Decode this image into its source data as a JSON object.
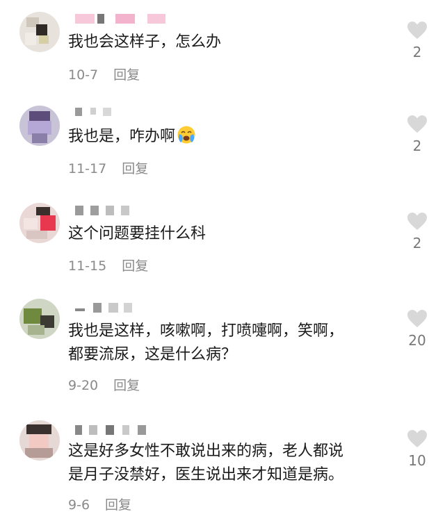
{
  "comments": [
    {
      "text": "我也会这样子，怎么办",
      "date": "10-7",
      "reply_label": "回复",
      "likes": "2"
    },
    {
      "text": "我也是，咋办啊",
      "emoji": "crying-face-emoji",
      "date": "11-17",
      "reply_label": "回复",
      "likes": "2"
    },
    {
      "text": "这个问题要挂什么科",
      "date": "11-15",
      "reply_label": "回复",
      "likes": "2"
    },
    {
      "text": "我也是这样，咳嗽啊，打喷嚏啊，笑啊，\n都要流尿，这是什么病？",
      "date": "9-20",
      "reply_label": "回复",
      "likes": "20"
    },
    {
      "text": "这是好多女性不敢说出来的病，老人都说\n是月子没禁好，医生说出来才知道是病。",
      "date": "9-6",
      "reply_label": "回复",
      "likes": "10"
    }
  ],
  "colors": {
    "like_heart": "#d8d8d8",
    "meta_text": "#8a8a8a",
    "body_text": "#1a1a1a"
  },
  "icons": {
    "like": "heart-icon",
    "avatar": "pixelated-avatar"
  }
}
